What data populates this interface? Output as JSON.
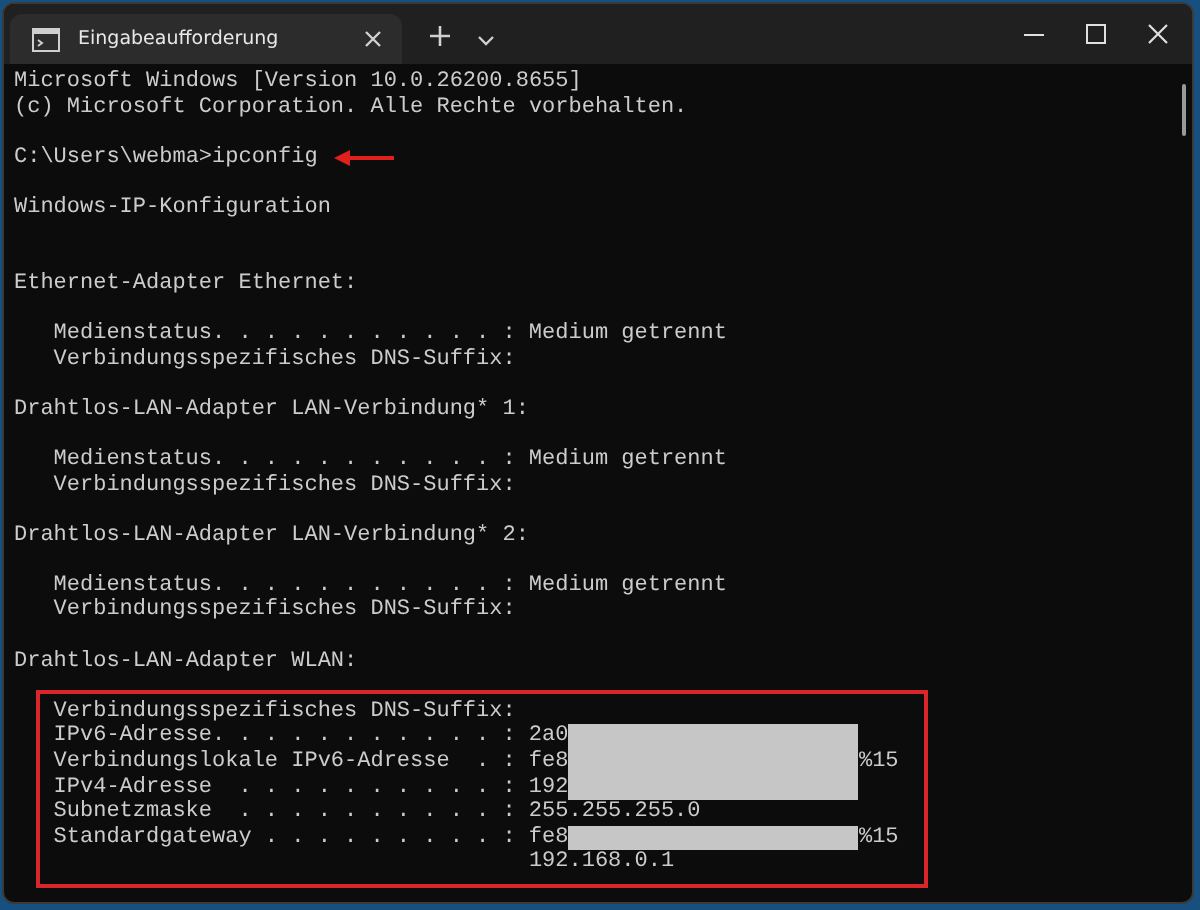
{
  "window": {
    "tab_title": "Eingabeaufforderung"
  },
  "terminal": {
    "banner": [
      "Microsoft Windows [Version 10.0.26200.8655]",
      "(c) Microsoft Corporation. Alle Rechte vorbehalten."
    ],
    "prompt": {
      "path": "C:\\Users\\webma>",
      "command": "ipconfig",
      "annotated": true
    },
    "heading": "Windows-IP-Konfiguration",
    "adapters": [
      {
        "name": "Ethernet-Adapter Ethernet:",
        "highlighted": false,
        "entries": [
          {
            "label": "Medienstatus. . . . . . . . . . . :",
            "value": "Medium getrennt"
          },
          {
            "label": "Verbindungsspezifisches DNS-Suffix:"
          }
        ]
      },
      {
        "name": "Drahtlos-LAN-Adapter LAN-Verbindung* 1:",
        "highlighted": false,
        "entries": [
          {
            "label": "Medienstatus. . . . . . . . . . . :",
            "value": "Medium getrennt"
          },
          {
            "label": "Verbindungsspezifisches DNS-Suffix:"
          }
        ]
      },
      {
        "name": "Drahtlos-LAN-Adapter LAN-Verbindung* 2:",
        "highlighted": false,
        "entries": [
          {
            "label": "Medienstatus. . . . . . . . . . . :",
            "value": "Medium getrennt"
          },
          {
            "label": "Verbindungsspezifisches DNS-Suffix:"
          }
        ]
      },
      {
        "name": "Drahtlos-LAN-Adapter WLAN:",
        "highlighted": true,
        "entries": [
          {
            "label": "Verbindungsspezifisches DNS-Suffix:"
          },
          {
            "label": "IPv6-Adresse. . . . . . . . . . . :",
            "value": "2a0",
            "redacted": true
          },
          {
            "label": "Verbindungslokale IPv6-Adresse  . :",
            "value": "fe8",
            "redacted": true,
            "suffix": "%15"
          },
          {
            "label": "IPv4-Adresse  . . . . . . . . . . :",
            "value": "192",
            "redacted": true
          },
          {
            "label": "Subnetzmaske  . . . . . . . . . . :",
            "value": "255.255.255.0"
          },
          {
            "label": "Standardgateway . . . . . . . . . :",
            "value": "fe8",
            "redacted": true,
            "suffix": "%15",
            "continuation": "192.168.0.1"
          }
        ]
      }
    ]
  }
}
